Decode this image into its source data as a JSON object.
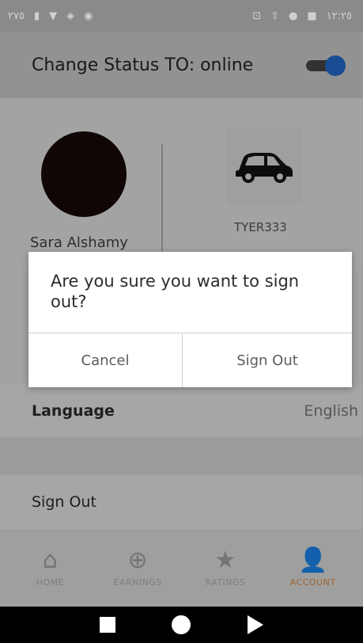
{
  "status_bar": {
    "left_text": "٢٧٥",
    "time": "١٢:٢٥",
    "icons": [
      "sim-icon",
      "wifi-icon",
      "vibrate-icon",
      "location-icon",
      "gallery-icon",
      "upload-icon",
      "messenger-icon",
      "image-icon"
    ]
  },
  "app_bar": {
    "title": "Change Status TO: online",
    "toggle_on": true
  },
  "profile": {
    "name": "Sara Alshamy",
    "plate": "TYER333",
    "icons": [
      "avatar",
      "car-icon"
    ]
  },
  "settings": {
    "language_label": "Language",
    "language_value": "English",
    "signout_label": "Sign Out"
  },
  "bottom_nav": {
    "items": [
      {
        "label": "HOME",
        "icon": "home-icon"
      },
      {
        "label": "EARNINGS",
        "icon": "earnings-icon"
      },
      {
        "label": "RATINGS",
        "icon": "star-icon"
      },
      {
        "label": "ACCOUNT",
        "icon": "account-icon"
      }
    ],
    "active_index": 3
  },
  "dialog": {
    "message": "Are you sure you want to sign out?",
    "cancel_label": "Cancel",
    "confirm_label": "Sign Out"
  },
  "colors": {
    "accent": "#c17a3a",
    "toggle_knob": "#1e5fb5"
  }
}
